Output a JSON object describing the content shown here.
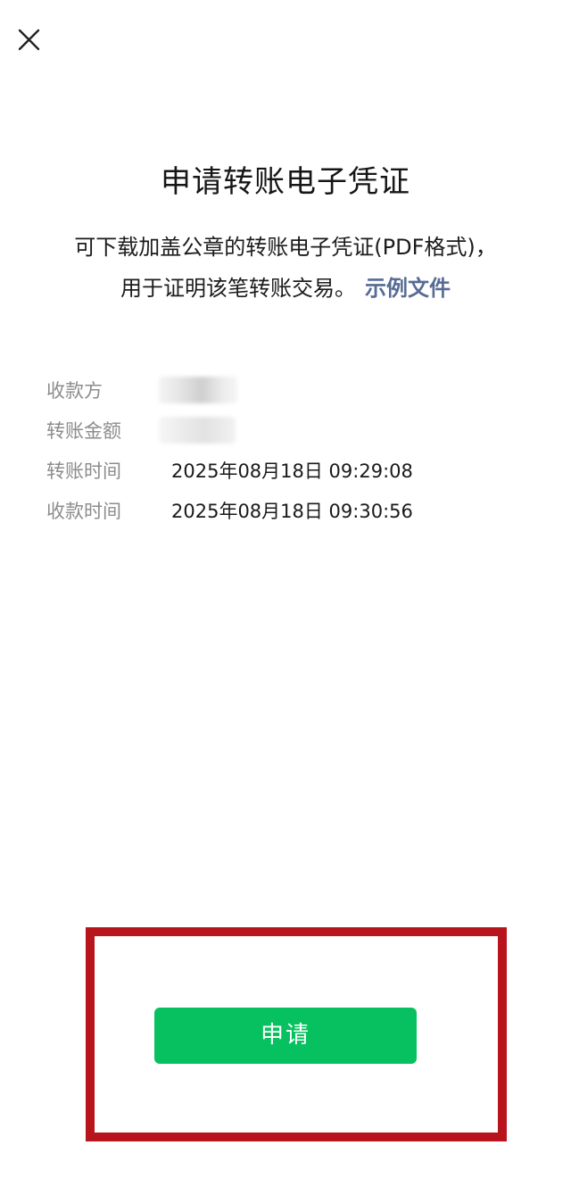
{
  "header": {
    "close_icon": "close-icon"
  },
  "title": "申请转账电子凭证",
  "description": {
    "line1": "可下载加盖公章的转账电子凭证(PDF格式)，",
    "line2": "用于证明该笔转账交易。",
    "link": "示例文件"
  },
  "details": {
    "payee": {
      "label": "收款方",
      "value": ""
    },
    "amount": {
      "label": "转账金额",
      "value": ""
    },
    "transfer_time": {
      "label": "转账时间",
      "value": "2025年08月18日 09:29:08"
    },
    "receive_time": {
      "label": "收款时间",
      "value": "2025年08月18日 09:30:56"
    }
  },
  "apply_button": {
    "label": "申请",
    "color": "#07c160"
  },
  "colors": {
    "link": "#576b95",
    "highlight_border": "#b8141b",
    "label_gray": "#8c8c8c"
  }
}
